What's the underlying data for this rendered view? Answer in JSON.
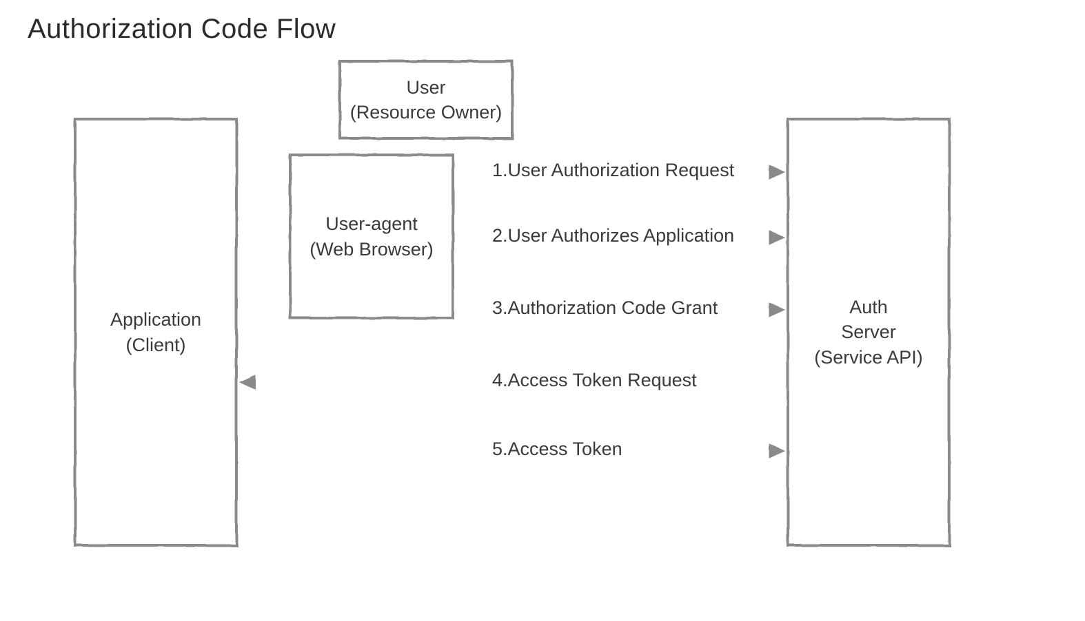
{
  "title": "Authorization Code Flow",
  "boxes": {
    "application": {
      "line1": "Application",
      "line2": "(Client)"
    },
    "user": {
      "line1": "User",
      "line2": "(Resource Owner)"
    },
    "useragent": {
      "line1": "User-agent",
      "line2": "(Web Browser)"
    },
    "authserver": {
      "line1": "Auth",
      "line2": "Server",
      "line3": "(Service API)"
    }
  },
  "flows": {
    "f1": "1.User Authorization Request",
    "f2": "2.User Authorizes Application",
    "f3": "3.Authorization Code Grant",
    "f4": "4.Access Token Request",
    "f5": "5.Access Token"
  },
  "color": "#8a8a8a"
}
